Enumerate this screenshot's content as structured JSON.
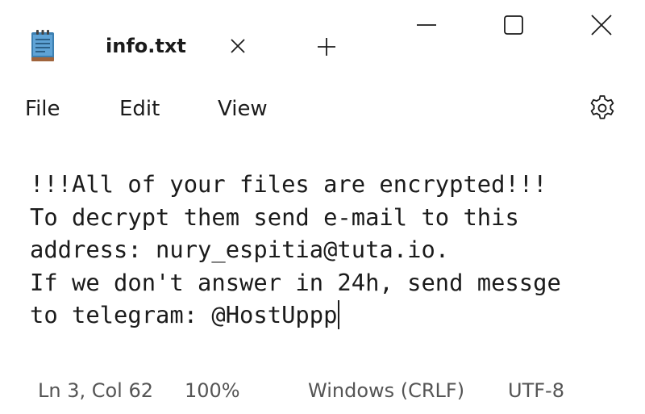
{
  "colors": {
    "background": "#ffffff",
    "text": "#1b1b1b",
    "status_text": "#555555",
    "icon_blue": "#3c7fb1",
    "icon_brown": "#a0643c"
  },
  "titlebar": {
    "tab_icon": "notepad-icon",
    "tab_title": "info.txt",
    "tab_close_icon": "close-icon",
    "new_tab_icon": "plus-icon",
    "window_controls": {
      "minimize_icon": "minimize-icon",
      "maximize_icon": "maximize-icon",
      "close_icon": "close-icon"
    }
  },
  "menubar": {
    "file": "File",
    "edit": "Edit",
    "view": "View",
    "settings_icon": "gear-icon"
  },
  "editor": {
    "lines": [
      "!!!All of your files are encrypted!!!",
      "To decrypt them send e-mail to this",
      "address: nury_espitia@tuta.io.",
      "If we don't answer in 24h, send messge",
      "to telegram: @HostUppp"
    ]
  },
  "statusbar": {
    "position": "Ln 3, Col 62",
    "zoom": "100%",
    "line_ending": "Windows (CRLF)",
    "encoding": "UTF-8"
  }
}
